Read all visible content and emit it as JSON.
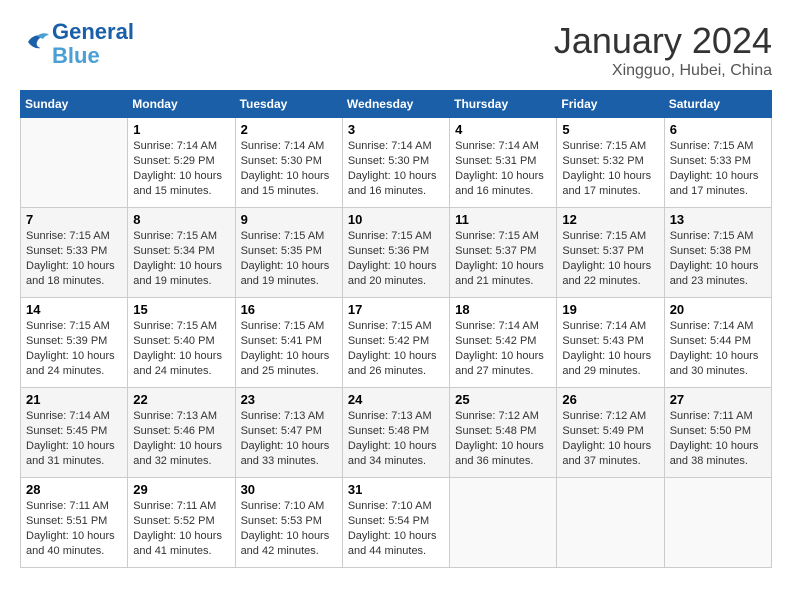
{
  "header": {
    "logo_line1": "General",
    "logo_line2": "Blue",
    "month": "January 2024",
    "location": "Xingguo, Hubei, China"
  },
  "weekdays": [
    "Sunday",
    "Monday",
    "Tuesday",
    "Wednesday",
    "Thursday",
    "Friday",
    "Saturday"
  ],
  "weeks": [
    [
      {
        "day": "",
        "info": ""
      },
      {
        "day": "1",
        "info": "Sunrise: 7:14 AM\nSunset: 5:29 PM\nDaylight: 10 hours\nand 15 minutes."
      },
      {
        "day": "2",
        "info": "Sunrise: 7:14 AM\nSunset: 5:30 PM\nDaylight: 10 hours\nand 15 minutes."
      },
      {
        "day": "3",
        "info": "Sunrise: 7:14 AM\nSunset: 5:30 PM\nDaylight: 10 hours\nand 16 minutes."
      },
      {
        "day": "4",
        "info": "Sunrise: 7:14 AM\nSunset: 5:31 PM\nDaylight: 10 hours\nand 16 minutes."
      },
      {
        "day": "5",
        "info": "Sunrise: 7:15 AM\nSunset: 5:32 PM\nDaylight: 10 hours\nand 17 minutes."
      },
      {
        "day": "6",
        "info": "Sunrise: 7:15 AM\nSunset: 5:33 PM\nDaylight: 10 hours\nand 17 minutes."
      }
    ],
    [
      {
        "day": "7",
        "info": "Sunrise: 7:15 AM\nSunset: 5:33 PM\nDaylight: 10 hours\nand 18 minutes."
      },
      {
        "day": "8",
        "info": "Sunrise: 7:15 AM\nSunset: 5:34 PM\nDaylight: 10 hours\nand 19 minutes."
      },
      {
        "day": "9",
        "info": "Sunrise: 7:15 AM\nSunset: 5:35 PM\nDaylight: 10 hours\nand 19 minutes."
      },
      {
        "day": "10",
        "info": "Sunrise: 7:15 AM\nSunset: 5:36 PM\nDaylight: 10 hours\nand 20 minutes."
      },
      {
        "day": "11",
        "info": "Sunrise: 7:15 AM\nSunset: 5:37 PM\nDaylight: 10 hours\nand 21 minutes."
      },
      {
        "day": "12",
        "info": "Sunrise: 7:15 AM\nSunset: 5:37 PM\nDaylight: 10 hours\nand 22 minutes."
      },
      {
        "day": "13",
        "info": "Sunrise: 7:15 AM\nSunset: 5:38 PM\nDaylight: 10 hours\nand 23 minutes."
      }
    ],
    [
      {
        "day": "14",
        "info": "Sunrise: 7:15 AM\nSunset: 5:39 PM\nDaylight: 10 hours\nand 24 minutes."
      },
      {
        "day": "15",
        "info": "Sunrise: 7:15 AM\nSunset: 5:40 PM\nDaylight: 10 hours\nand 24 minutes."
      },
      {
        "day": "16",
        "info": "Sunrise: 7:15 AM\nSunset: 5:41 PM\nDaylight: 10 hours\nand 25 minutes."
      },
      {
        "day": "17",
        "info": "Sunrise: 7:15 AM\nSunset: 5:42 PM\nDaylight: 10 hours\nand 26 minutes."
      },
      {
        "day": "18",
        "info": "Sunrise: 7:14 AM\nSunset: 5:42 PM\nDaylight: 10 hours\nand 27 minutes."
      },
      {
        "day": "19",
        "info": "Sunrise: 7:14 AM\nSunset: 5:43 PM\nDaylight: 10 hours\nand 29 minutes."
      },
      {
        "day": "20",
        "info": "Sunrise: 7:14 AM\nSunset: 5:44 PM\nDaylight: 10 hours\nand 30 minutes."
      }
    ],
    [
      {
        "day": "21",
        "info": "Sunrise: 7:14 AM\nSunset: 5:45 PM\nDaylight: 10 hours\nand 31 minutes."
      },
      {
        "day": "22",
        "info": "Sunrise: 7:13 AM\nSunset: 5:46 PM\nDaylight: 10 hours\nand 32 minutes."
      },
      {
        "day": "23",
        "info": "Sunrise: 7:13 AM\nSunset: 5:47 PM\nDaylight: 10 hours\nand 33 minutes."
      },
      {
        "day": "24",
        "info": "Sunrise: 7:13 AM\nSunset: 5:48 PM\nDaylight: 10 hours\nand 34 minutes."
      },
      {
        "day": "25",
        "info": "Sunrise: 7:12 AM\nSunset: 5:48 PM\nDaylight: 10 hours\nand 36 minutes."
      },
      {
        "day": "26",
        "info": "Sunrise: 7:12 AM\nSunset: 5:49 PM\nDaylight: 10 hours\nand 37 minutes."
      },
      {
        "day": "27",
        "info": "Sunrise: 7:11 AM\nSunset: 5:50 PM\nDaylight: 10 hours\nand 38 minutes."
      }
    ],
    [
      {
        "day": "28",
        "info": "Sunrise: 7:11 AM\nSunset: 5:51 PM\nDaylight: 10 hours\nand 40 minutes."
      },
      {
        "day": "29",
        "info": "Sunrise: 7:11 AM\nSunset: 5:52 PM\nDaylight: 10 hours\nand 41 minutes."
      },
      {
        "day": "30",
        "info": "Sunrise: 7:10 AM\nSunset: 5:53 PM\nDaylight: 10 hours\nand 42 minutes."
      },
      {
        "day": "31",
        "info": "Sunrise: 7:10 AM\nSunset: 5:54 PM\nDaylight: 10 hours\nand 44 minutes."
      },
      {
        "day": "",
        "info": ""
      },
      {
        "day": "",
        "info": ""
      },
      {
        "day": "",
        "info": ""
      }
    ]
  ]
}
